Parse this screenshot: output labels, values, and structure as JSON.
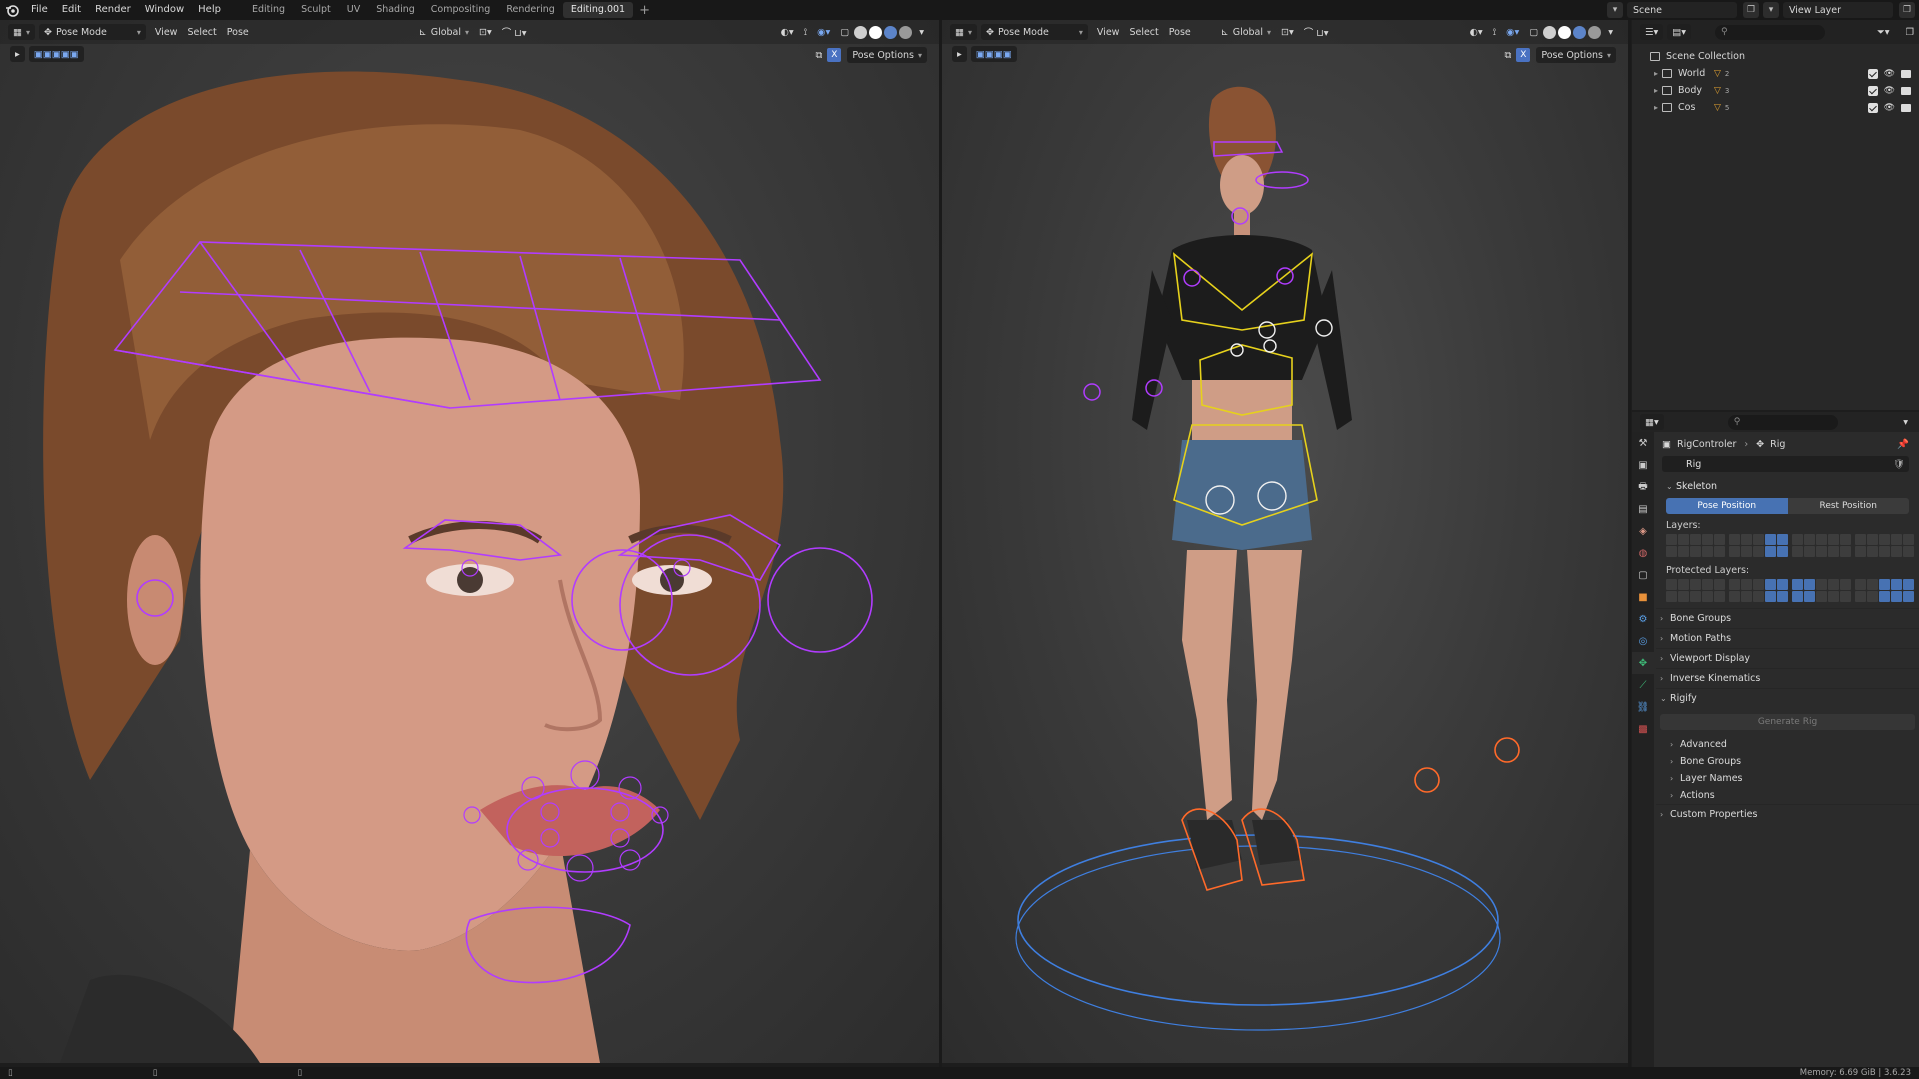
{
  "menu": {
    "items": [
      "File",
      "Edit",
      "Render",
      "Window",
      "Help"
    ],
    "workspaces": [
      "Editing",
      "Sculpt",
      "UV",
      "Shading",
      "Compositing",
      "Rendering",
      "Editing.001"
    ],
    "active_workspace": "Editing.001"
  },
  "top_right": {
    "scene": "Scene",
    "view_layer": "View Layer"
  },
  "viewport_left": {
    "mode": "Pose Mode",
    "menus": [
      "View",
      "Select",
      "Pose"
    ],
    "transform": "Global",
    "pose_options": "Pose Options"
  },
  "viewport_right": {
    "mode": "Pose Mode",
    "menus": [
      "View",
      "Select",
      "Pose"
    ],
    "transform": "Global",
    "pose_options": "Pose Options"
  },
  "outliner": {
    "root": "Scene Collection",
    "rows": [
      {
        "name": "World",
        "badge": "2"
      },
      {
        "name": "Body",
        "badge": "3"
      },
      {
        "name": "Cos",
        "badge": "5"
      }
    ]
  },
  "properties": {
    "breadcrumb": [
      "RigControler",
      "Rig"
    ],
    "data_name": "Rig",
    "skeleton": {
      "title": "Skeleton",
      "pose_position": "Pose Position",
      "rest_position": "Rest Position",
      "layers_label": "Layers:",
      "protected_label": "Protected Layers:"
    },
    "panels": [
      "Bone Groups",
      "Motion Paths",
      "Viewport Display",
      "Inverse Kinematics"
    ],
    "rigify": {
      "title": "Rigify",
      "generate": "Generate Rig",
      "sub": [
        "Advanced",
        "Bone Groups",
        "Layer Names",
        "Actions"
      ]
    },
    "custom": "Custom Properties"
  },
  "status": {
    "memory": "Memory: 6.69 GiB | 3.6.23"
  },
  "colors": {
    "accent": "#4772b3",
    "rig_purple": "#b13cff",
    "rig_yellow": "#e6d11c",
    "rig_blue": "#3f7fe0",
    "rig_orange": "#ff6a2a"
  }
}
